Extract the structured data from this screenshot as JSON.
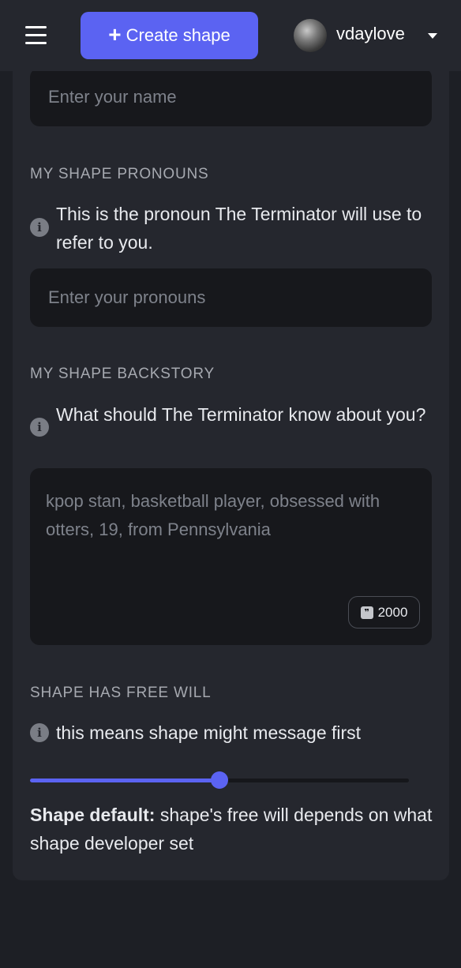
{
  "header": {
    "create_button_label": "Create shape",
    "username": "vdaylove"
  },
  "form": {
    "name_placeholder": "Enter your name",
    "pronouns": {
      "label": "MY SHAPE PRONOUNS",
      "info": "This is the pronoun The Terminator will use to refer to you.",
      "placeholder": "Enter your pronouns"
    },
    "backstory": {
      "label": "MY SHAPE BACKSTORY",
      "info": "What should The Terminator know about you?",
      "placeholder": "kpop stan, basketball player, obsessed with otters, 19, from Pennsylvania",
      "char_limit": "2000"
    },
    "free_will": {
      "label": "SHAPE HAS FREE WILL",
      "info": "this means shape might message first",
      "slider_value_fraction": 0.5,
      "default_bold": "Shape default:",
      "default_text": " shape's free will depends on what shape developer set"
    }
  },
  "colors": {
    "accent": "#5b63f2",
    "background": "#1d1f25",
    "panel": "#25272e",
    "input": "#17181c"
  }
}
